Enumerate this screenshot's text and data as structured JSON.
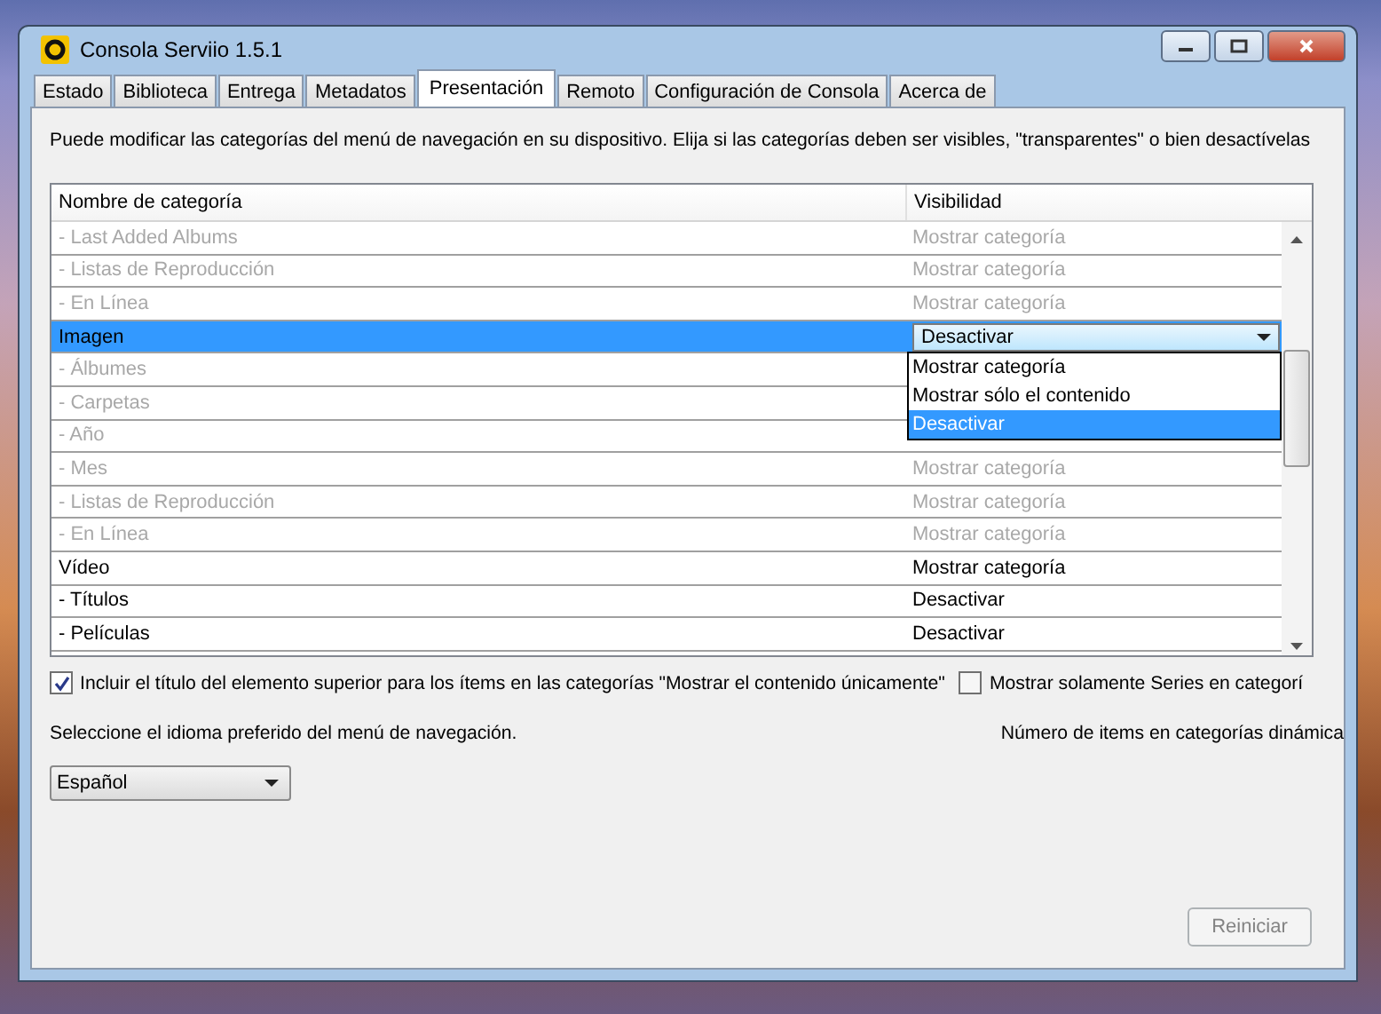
{
  "window": {
    "title": "Consola Serviio 1.5.1"
  },
  "tabs": [
    {
      "label": "Estado",
      "selected": false
    },
    {
      "label": "Biblioteca",
      "selected": false
    },
    {
      "label": "Entrega",
      "selected": false
    },
    {
      "label": "Metadatos",
      "selected": false
    },
    {
      "label": "Presentación",
      "selected": true
    },
    {
      "label": "Remoto",
      "selected": false
    },
    {
      "label": "Configuración de Consola",
      "selected": false
    },
    {
      "label": "Acerca de",
      "selected": false
    }
  ],
  "description": "Puede modificar las categorías del menú de navegación en su dispositivo. Elija si las categorías deben ser visibles, \"transparentes\" o bien desactívelas",
  "table": {
    "columns": [
      "Nombre de categoría",
      "Visibilidad"
    ],
    "rows": [
      {
        "name": "- Last Added Albums",
        "visibility": "Mostrar categoría",
        "disabled": true,
        "selected": false
      },
      {
        "name": "- Listas de Reproducción",
        "visibility": "Mostrar categoría",
        "disabled": true,
        "selected": false
      },
      {
        "name": "- En Línea",
        "visibility": "Mostrar categoría",
        "disabled": true,
        "selected": false
      },
      {
        "name": "Imagen",
        "visibility": "Desactivar",
        "disabled": false,
        "selected": true,
        "expanded": true,
        "options": [
          {
            "label": "Mostrar categoría",
            "selected": false
          },
          {
            "label": "Mostrar sólo el contenido",
            "selected": false
          },
          {
            "label": "Desactivar",
            "selected": true
          }
        ]
      },
      {
        "name": "- Álbumes",
        "disabled": true,
        "selected": false
      },
      {
        "name": "- Carpetas",
        "disabled": true,
        "selected": false
      },
      {
        "name": "- Año",
        "disabled": true,
        "selected": false
      },
      {
        "name": "- Mes",
        "visibility": "Mostrar categoría",
        "disabled": true,
        "selected": false
      },
      {
        "name": "- Listas de Reproducción",
        "visibility": "Mostrar categoría",
        "disabled": true,
        "selected": false
      },
      {
        "name": "- En Línea",
        "visibility": "Mostrar categoría",
        "disabled": true,
        "selected": false
      },
      {
        "name": "Vídeo",
        "visibility": "Mostrar categoría",
        "disabled": false,
        "selected": false
      },
      {
        "name": "- Títulos",
        "visibility": "Desactivar",
        "disabled": false,
        "selected": false
      },
      {
        "name": "- Películas",
        "visibility": "Desactivar",
        "disabled": false,
        "selected": false
      }
    ]
  },
  "checkboxes": [
    {
      "label": "Incluir el título del elemento superior para los ítems en las categorías \"Mostrar el contenido únicamente\"",
      "checked": true
    },
    {
      "label": "Mostrar solamente Series en categorí",
      "checked": false
    }
  ],
  "language": {
    "label": "Seleccione el idioma preferido del menú de navegación.",
    "value": "Español"
  },
  "dynamic_label": "Número de items en categorías dinámica",
  "buttons": [
    {
      "label": "Reiniciar",
      "disabled": true
    }
  ]
}
